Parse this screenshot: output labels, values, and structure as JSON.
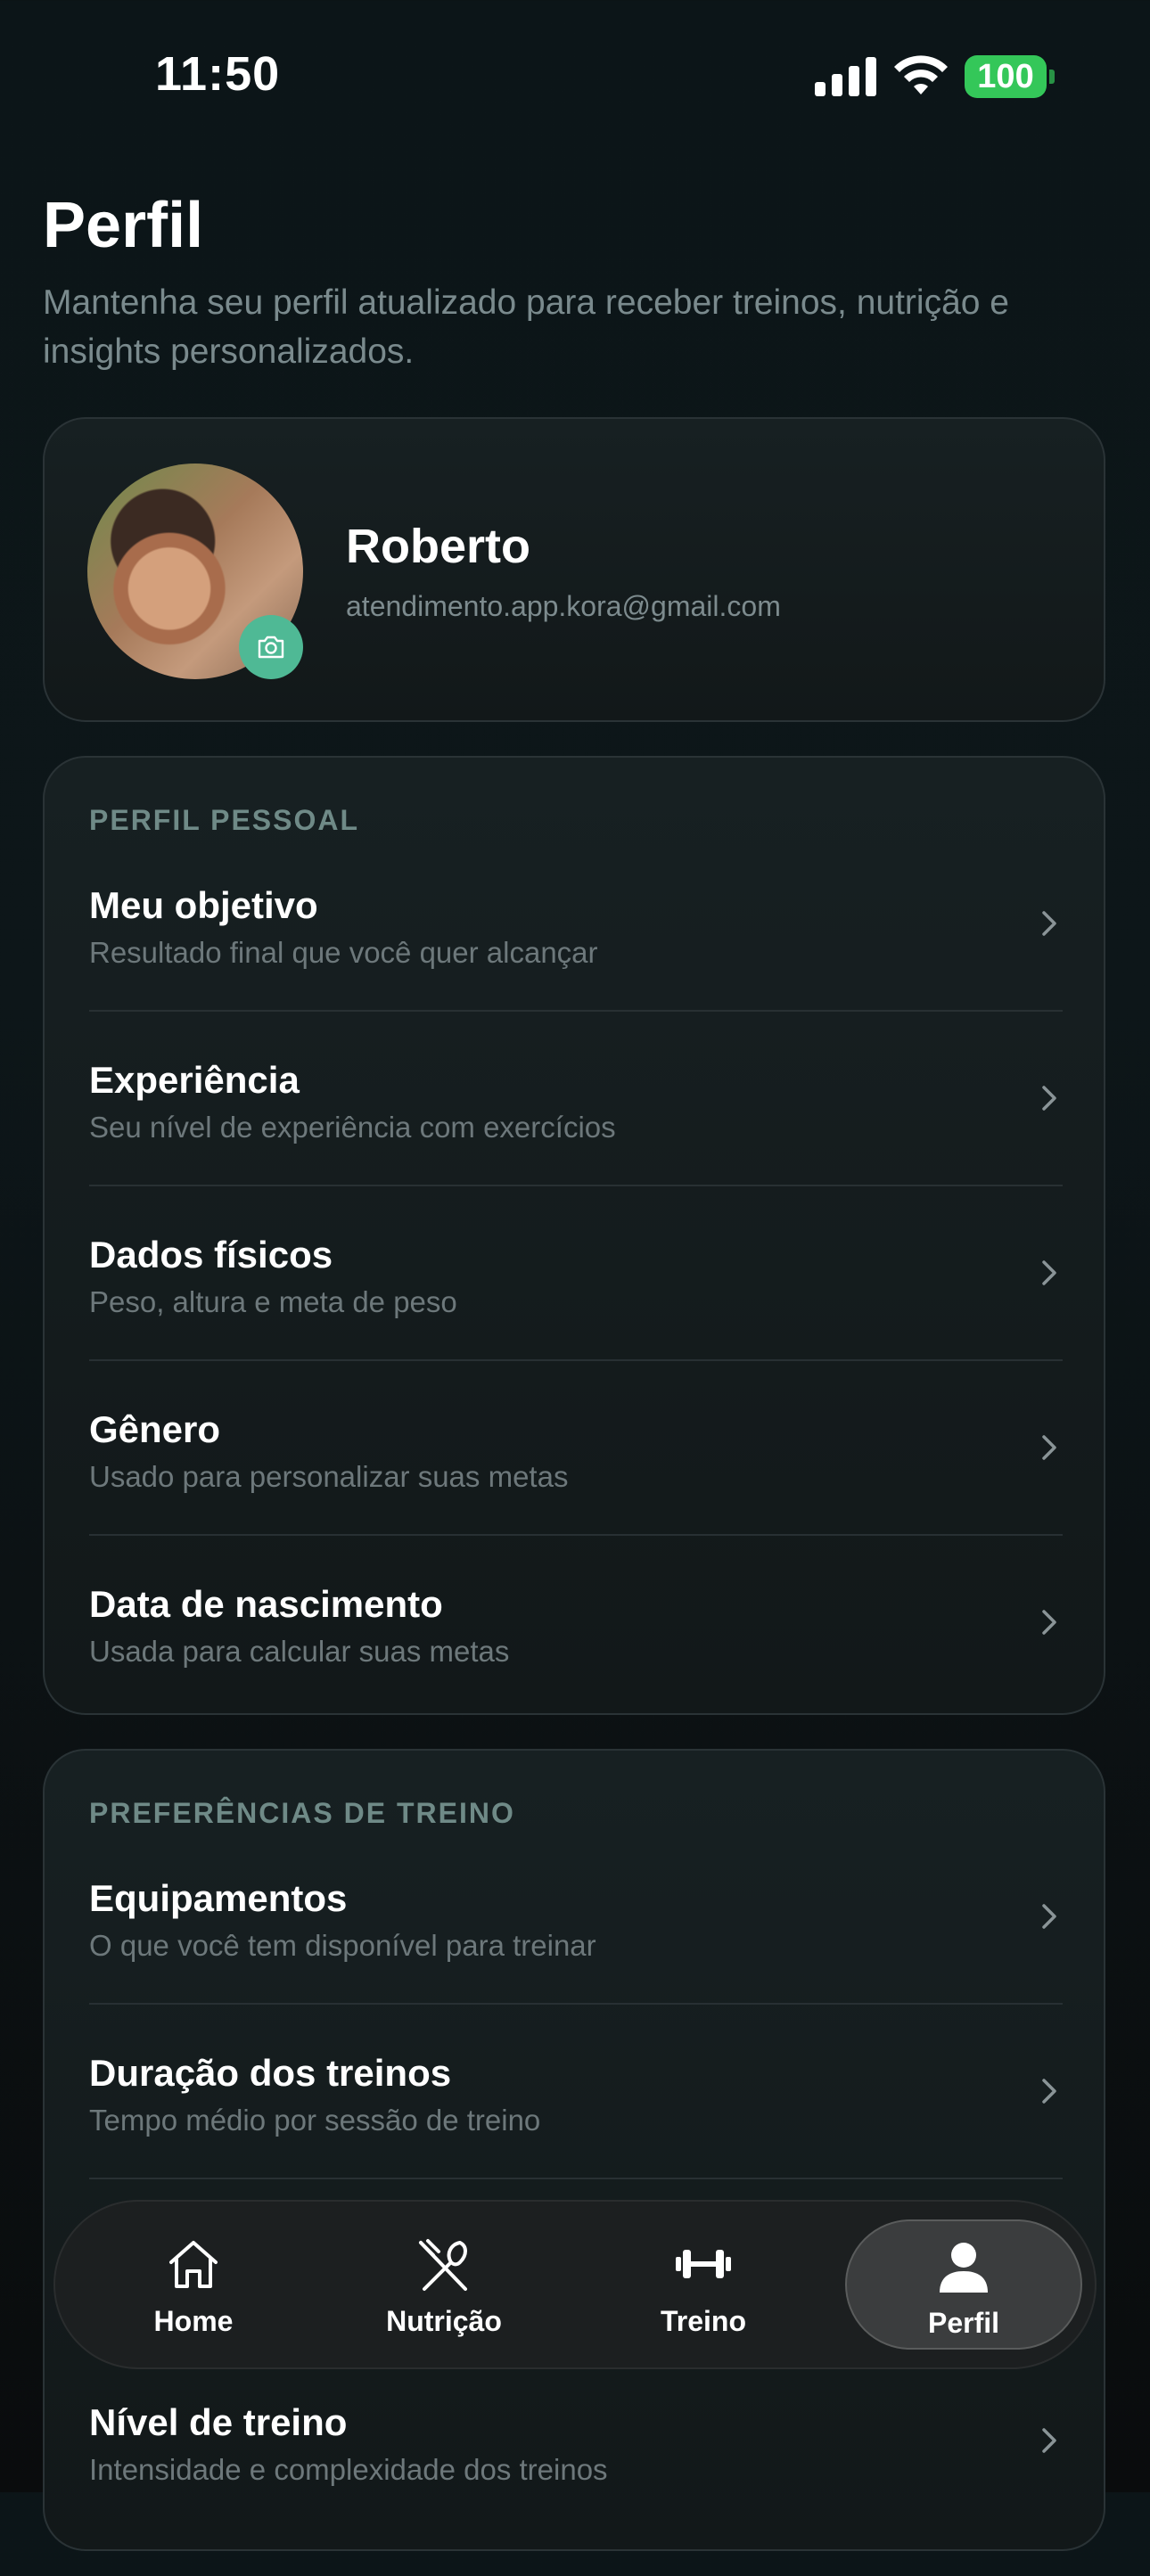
{
  "status_bar": {
    "time": "11:50",
    "battery": "100"
  },
  "header": {
    "title": "Perfil",
    "subtitle": "Mantenha seu perfil atualizado para receber treinos, nutrição e insights personalizados."
  },
  "profile": {
    "name": "Roberto",
    "email": "atendimento.app.kora@gmail.com"
  },
  "personal": {
    "section_label": "PERFIL PESSOAL",
    "items": [
      {
        "title": "Meu objetivo",
        "subtitle": "Resultado final que você quer alcançar"
      },
      {
        "title": "Experiência",
        "subtitle": "Seu nível de experiência com exercícios"
      },
      {
        "title": "Dados físicos",
        "subtitle": "Peso, altura e meta de peso"
      },
      {
        "title": "Gênero",
        "subtitle": "Usado para personalizar suas metas"
      },
      {
        "title": "Data de nascimento",
        "subtitle": "Usada para calcular suas metas"
      }
    ]
  },
  "training": {
    "section_label": "PREFERÊNCIAS DE TREINO",
    "items": [
      {
        "title": "Equipamentos",
        "subtitle": "O que você tem disponível para treinar"
      },
      {
        "title": "Duração dos treinos",
        "subtitle": "Tempo médio por sessão de treino"
      },
      {
        "title": "Nível de treino",
        "subtitle": "Intensidade e complexidade dos treinos"
      }
    ]
  },
  "tabbar": {
    "items": [
      {
        "label": "Home",
        "icon": "home-icon"
      },
      {
        "label": "Nutrição",
        "icon": "fork-knife-icon"
      },
      {
        "label": "Treino",
        "icon": "dumbbell-icon"
      },
      {
        "label": "Perfil",
        "icon": "person-icon"
      }
    ],
    "active": "Perfil"
  },
  "colors": {
    "accent": "#4fb995",
    "battery": "#34c759",
    "background": "#0c1518"
  }
}
